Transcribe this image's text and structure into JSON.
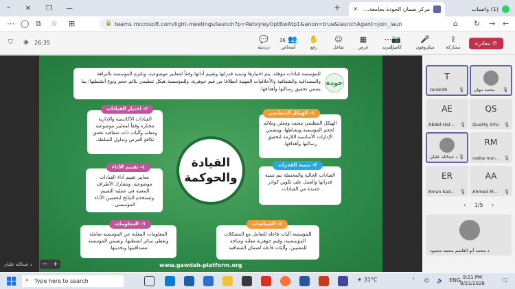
{
  "browser": {
    "tabs": [
      {
        "title": "مركز ضمان الجودة بجامعة فنا - ال",
        "active": true
      },
      {
        "title": "(1) واتساب",
        "active": false
      }
    ],
    "url": "teams.microsoft.com/light-meetings/launch?p=RetxyieyOptBwAtp1&anon=true&launchAgent=join_launcher_web&lo"
  },
  "meeting": {
    "timer": "26:35",
    "leave_label": "مغادرة",
    "tools": [
      {
        "label": "مشاركة",
        "icon": "share-icon"
      },
      {
        "label": "ميكروفون",
        "icon": "microphone-icon"
      },
      {
        "label": "كاميرا",
        "icon": "camera-icon"
      },
      {
        "label": "المزيد",
        "icon": "more-icon"
      },
      {
        "label": "عرض",
        "icon": "view-icon"
      },
      {
        "label": "تفاعل",
        "icon": "react-icon"
      },
      {
        "label": "رفع",
        "icon": "raise-hand-icon"
      },
      {
        "label": "أشخاص",
        "icon": "people-icon",
        "badge": "36"
      },
      {
        "label": "دردشة",
        "icon": "chat-icon"
      }
    ]
  },
  "slide": {
    "intro": "للمؤسسة قيادات مؤهلة، يتم اختيارها وتنمية قدراتها وتقييم أدائها وفقاً لمعايير موضوعية، وتلتزم المؤسسة بالنزاهة والمصداقية والشفافية والأخلاقيات المهنية انطلاقا من قيم جوهرية. وللمؤسسة هيكل تنظيمي يلائم حجم ونوع أنشطتها؛ بما يضمن تحقيق رسالتها وأهدافها.",
    "center_line1": "القيادة",
    "center_line2": "والحوكمة",
    "footer_url": "www.gawdah-platform.org",
    "boxes": [
      {
        "title": "١- الهيكل التنظيمي",
        "text": "الهيكل التنظيمي معتمد ومعلن وملائم لحجم المؤسسة ونشاطها، ويتضمن الإدارات الأساسية اللازمة لتحقيق رسالتها وأهدافها."
      },
      {
        "title": "٢- اختيار القيادات",
        "text": "القيادات الأكاديمية والإدارية مختارة وفقاً لمعايير موضوعية ومعلنة وآليات ذات شفافية تحقق تكافؤ الفرص وتداول السلطة."
      },
      {
        "title": "٣- تنمية القدرات",
        "text": "القيادات الحالية والمحتملة يتم تنمية قدراتها والعمل على تكوين كوادر جديدة من القيادات."
      },
      {
        "title": "٤- تقييم الأداء",
        "text": "معايير تقييم أداء القيادات موضوعية، وتشارك الأطراف المعنية في عملية التقييم، وتستخدم النتائج لتحسين الأداء المؤسسي."
      },
      {
        "title": "٥- السياسات",
        "text": "للمؤسسة آليات فاعلة للتعامل مع المشكلات المؤسسية، وقيم جوهرية معلنة ومتاحة للمعنيين، وآليات فاعلة لضمان الشفافية"
      },
      {
        "title": "٦- المعلومات",
        "text": "المعلومات المعلنة عن المؤسسة شاملة وتغطي سائر أنشطتها، وتضمن المؤسسة مصداقيتها وتحديثها."
      }
    ],
    "sharer": "د عبدالله عليان"
  },
  "participants": {
    "tiles": [
      {
        "initials": "",
        "name": "محمد نبهان",
        "avatar": true
      },
      {
        "initials": "T",
        "name": "tarek98",
        "avatar": false
      },
      {
        "initials": "QS",
        "name": "Quality SVU",
        "avatar": false
      },
      {
        "initials": "AE",
        "name": "Abdel-Hal...",
        "avatar": false
      },
      {
        "initials": "RM",
        "name": "rasha mor...",
        "avatar": false
      },
      {
        "initials": "",
        "name": "د عبدالله عليان",
        "avatar": true
      },
      {
        "initials": "AA",
        "name": "Ahmed M...",
        "avatar": false
      },
      {
        "initials": "ER",
        "name": "Eman kad...",
        "avatar": false
      }
    ],
    "pager": "1/5",
    "self_name": "د محمد أبو القاسم محمد محمود"
  },
  "taskbar": {
    "search_placeholder": "Type here to search",
    "weather": "31°C",
    "time": "9:21 PM",
    "date": "9/23/2026"
  },
  "colors": {
    "slide_green": "#2e8a4a",
    "label_pink": "#c0569a",
    "label_orange": "#f39b33",
    "label_blue": "#2da6df",
    "leave_red": "#c4314b"
  }
}
